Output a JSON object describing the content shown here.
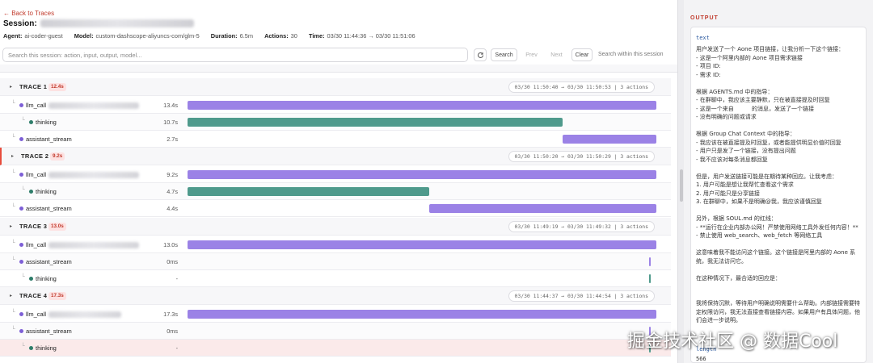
{
  "nav": {
    "back_label": "← Back to Traces"
  },
  "session": {
    "title_prefix": "Session:",
    "agent_label": "Agent:",
    "agent": "ai-coder-guest",
    "model_label": "Model:",
    "model": "custom-dashscope-aliyuncs-com/glm-5",
    "duration_label": "Duration:",
    "duration": "6.5m",
    "actions_label": "Actions:",
    "actions": "30",
    "time_label": "Time:",
    "time": "03/30 11:44:36 → 03/30 11:51:06"
  },
  "search": {
    "placeholder": "Search this session: action, input, output, model...",
    "search_label": "Search",
    "prev_label": "Prev",
    "next_label": "Next",
    "clear_label": "Clear",
    "scope_label": "Search within this session"
  },
  "traces": [
    {
      "label": "TRACE 1",
      "badge": "12.4s",
      "range": "03/30 11:50:40 → 03/30 11:50:53 | 3 actions",
      "spans": [
        {
          "name": "llm_call",
          "dur": "13.4s",
          "color": "purple",
          "start": 0.0,
          "end": 1.0,
          "depth": 1
        },
        {
          "name": "thinking",
          "dur": "10.7s",
          "color": "green",
          "start": 0.0,
          "end": 0.8,
          "depth": 2
        },
        {
          "name": "assistant_stream",
          "dur": "2.7s",
          "color": "purple",
          "start": 0.8,
          "end": 1.0,
          "depth": 1
        }
      ]
    },
    {
      "label": "TRACE 2",
      "badge": "9.2s",
      "range": "03/30 11:50:20 → 03/30 11:50:29 | 3 actions",
      "spans": [
        {
          "name": "llm_call",
          "dur": "9.2s",
          "color": "purple",
          "start": 0.0,
          "end": 1.0,
          "depth": 1
        },
        {
          "name": "thinking",
          "dur": "4.7s",
          "color": "green",
          "start": 0.0,
          "end": 0.515,
          "depth": 2
        },
        {
          "name": "assistant_stream",
          "dur": "4.4s",
          "color": "purple",
          "start": 0.515,
          "end": 1.0,
          "depth": 1
        }
      ]
    },
    {
      "label": "TRACE 3",
      "badge": "13.0s",
      "range": "03/30 11:49:19 → 03/30 11:49:32 | 3 actions",
      "spans": [
        {
          "name": "llm_call",
          "dur": "13.0s",
          "color": "purple",
          "start": 0.0,
          "end": 1.0,
          "depth": 1
        },
        {
          "name": "assistant_stream",
          "dur": "0ms",
          "color": "purple",
          "start": 0.995,
          "end": 0.995,
          "depth": 1
        },
        {
          "name": "thinking",
          "dur": "-",
          "color": "green",
          "start": 0.995,
          "end": 0.995,
          "depth": 2
        }
      ]
    },
    {
      "label": "TRACE 4",
      "badge": "17.3s",
      "range": "03/30 11:44:37 → 03/30 11:44:54 | 3 actions",
      "spans": [
        {
          "name": "llm_call",
          "dur": "17.3s",
          "color": "purple",
          "start": 0.0,
          "end": 1.0,
          "depth": 1
        },
        {
          "name": "assistant_stream",
          "dur": "0ms",
          "color": "purple",
          "start": 0.995,
          "end": 0.995,
          "depth": 1
        },
        {
          "name": "thinking",
          "dur": "-",
          "color": "green",
          "start": 0.995,
          "end": 0.995,
          "depth": 2
        }
      ]
    }
  ],
  "output": {
    "title": "OUTPUT",
    "key_text": "text",
    "text": "用户发送了一个 Aone 项目链接，让我分析一下这个链接：\n- 这是一个阿里内部的 Aone 项目需求链接\n- 项目 ID:\n- 需求 ID:\n\n根据 AGENTS.md 中的指导：\n- 在群聊中，我应该主要静默，只在被直接提及时回复\n- 这是一个来自          的消息，发送了一个链接\n- 没有明确的问题或请求\n\n根据 Group Chat Context 中的指导：\n- 我应该在被直接提及时回复，或者能提供明显价值时回复\n- 用户只是发了一个链接，没有提出问题\n- 我不应该对每条消息都回复\n\n但是，用户发送链接可能是在期待某种回应。让我考虑：\n1. 用户可能是想让我帮忙查看这个需求\n2. 用户可能只是分享链接\n3. 在群聊中，如果不是明确@我，我应该谨慎回复\n\n另外，根据 SOUL.md 的红线：\n- **运行在企业内部办公网！严禁使用网络工具外发任何内容！**\n- 禁止使用 web_search、web_fetch 等网络工具\n\n这意味着我不能访问这个链接。这个链接是阿里内部的 Aone 系\n统，我无法访问它。\n\n在这种情况下，最合适的回应是：\n\n\n我将保持沉默，等待用户明确说明需要什么帮助。内部链接需要特\n定权限访问，我无法直接查看链接内容。如果用户有具体问题，他\n们会进一步说明。",
    "key_length": "length",
    "length": "566"
  },
  "watermark": "掘金技术社区 @ 数据Cool",
  "colors": {
    "accent": "#c0392b",
    "purple_bar": "#9b82e6",
    "green_bar": "#4f9a8c",
    "badge_bg": "#fde2e2"
  }
}
